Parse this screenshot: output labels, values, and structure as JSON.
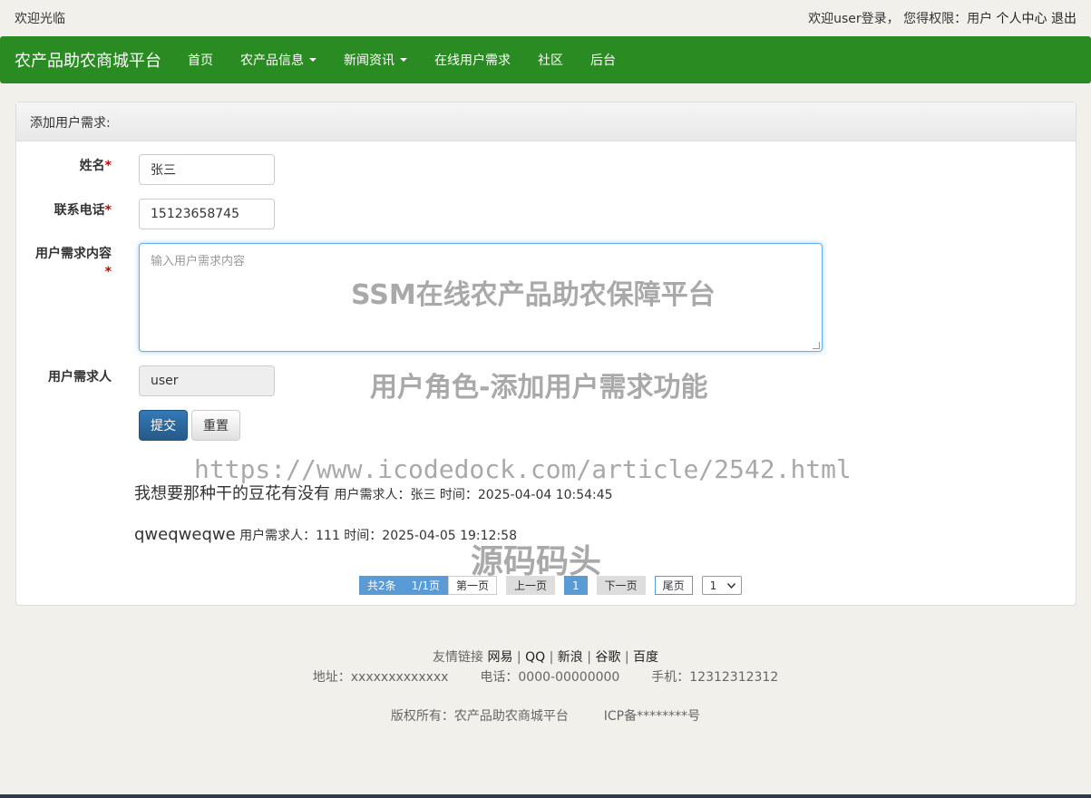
{
  "topbar": {
    "welcome": "欢迎光临",
    "login_info": "欢迎user登录，  您得权限：用户",
    "profile_link": "个人中心",
    "logout_link": "退出"
  },
  "nav": {
    "brand": "农产品助农商城平台",
    "items": [
      {
        "label": "首页",
        "dropdown": false
      },
      {
        "label": "农产品信息",
        "dropdown": true
      },
      {
        "label": "新闻资讯",
        "dropdown": true
      },
      {
        "label": "在线用户需求",
        "dropdown": false
      },
      {
        "label": "社区",
        "dropdown": false
      },
      {
        "label": "后台",
        "dropdown": false
      }
    ]
  },
  "form": {
    "heading": "添加用户需求:",
    "name_label": "姓名",
    "name_value": "张三",
    "phone_label": "联系电话",
    "phone_value": "15123658745",
    "content_label": "用户需求内容",
    "content_placeholder": "输入用户需求内容",
    "requester_label": "用户需求人",
    "requester_value": "user",
    "required_mark": "*",
    "submit_label": "提交",
    "reset_label": "重置"
  },
  "requests": [
    {
      "content": "我想要那种干的豆花有没有",
      "meta": "用户需求人：张三 时间：2025-04-04 10:54:45"
    },
    {
      "content": "qweqweqwe",
      "meta": "用户需求人：111 时间：2025-04-05 19:12:58"
    }
  ],
  "pager": {
    "total": "共2条",
    "pages": "1/1页",
    "first": "第一页",
    "prev": "上一页",
    "current": "1",
    "next": "下一页",
    "last": "尾页",
    "select_value": "1"
  },
  "footer": {
    "links_label": "友情链接",
    "links": [
      "网易",
      "QQ",
      "新浪",
      "谷歌",
      "百度"
    ],
    "separator": "|",
    "address": "地址：xxxxxxxxxxxxx",
    "phone": "电话：0000-00000000",
    "mobile": "手机：12312312312",
    "copyright": "版权所有：农产品助农商城平台",
    "icp": "ICP备********号"
  },
  "watermarks": {
    "title": "SSM在线农产品助农保障平台",
    "subtitle": "用户角色-添加用户需求功能",
    "url": "https://www.icodedock.com/article/2542.html",
    "brand": "源码码头"
  },
  "colors": {
    "nav_bg": "#2a8b22",
    "primary": "#337ab7",
    "pager_blue": "#5b9bd5"
  }
}
